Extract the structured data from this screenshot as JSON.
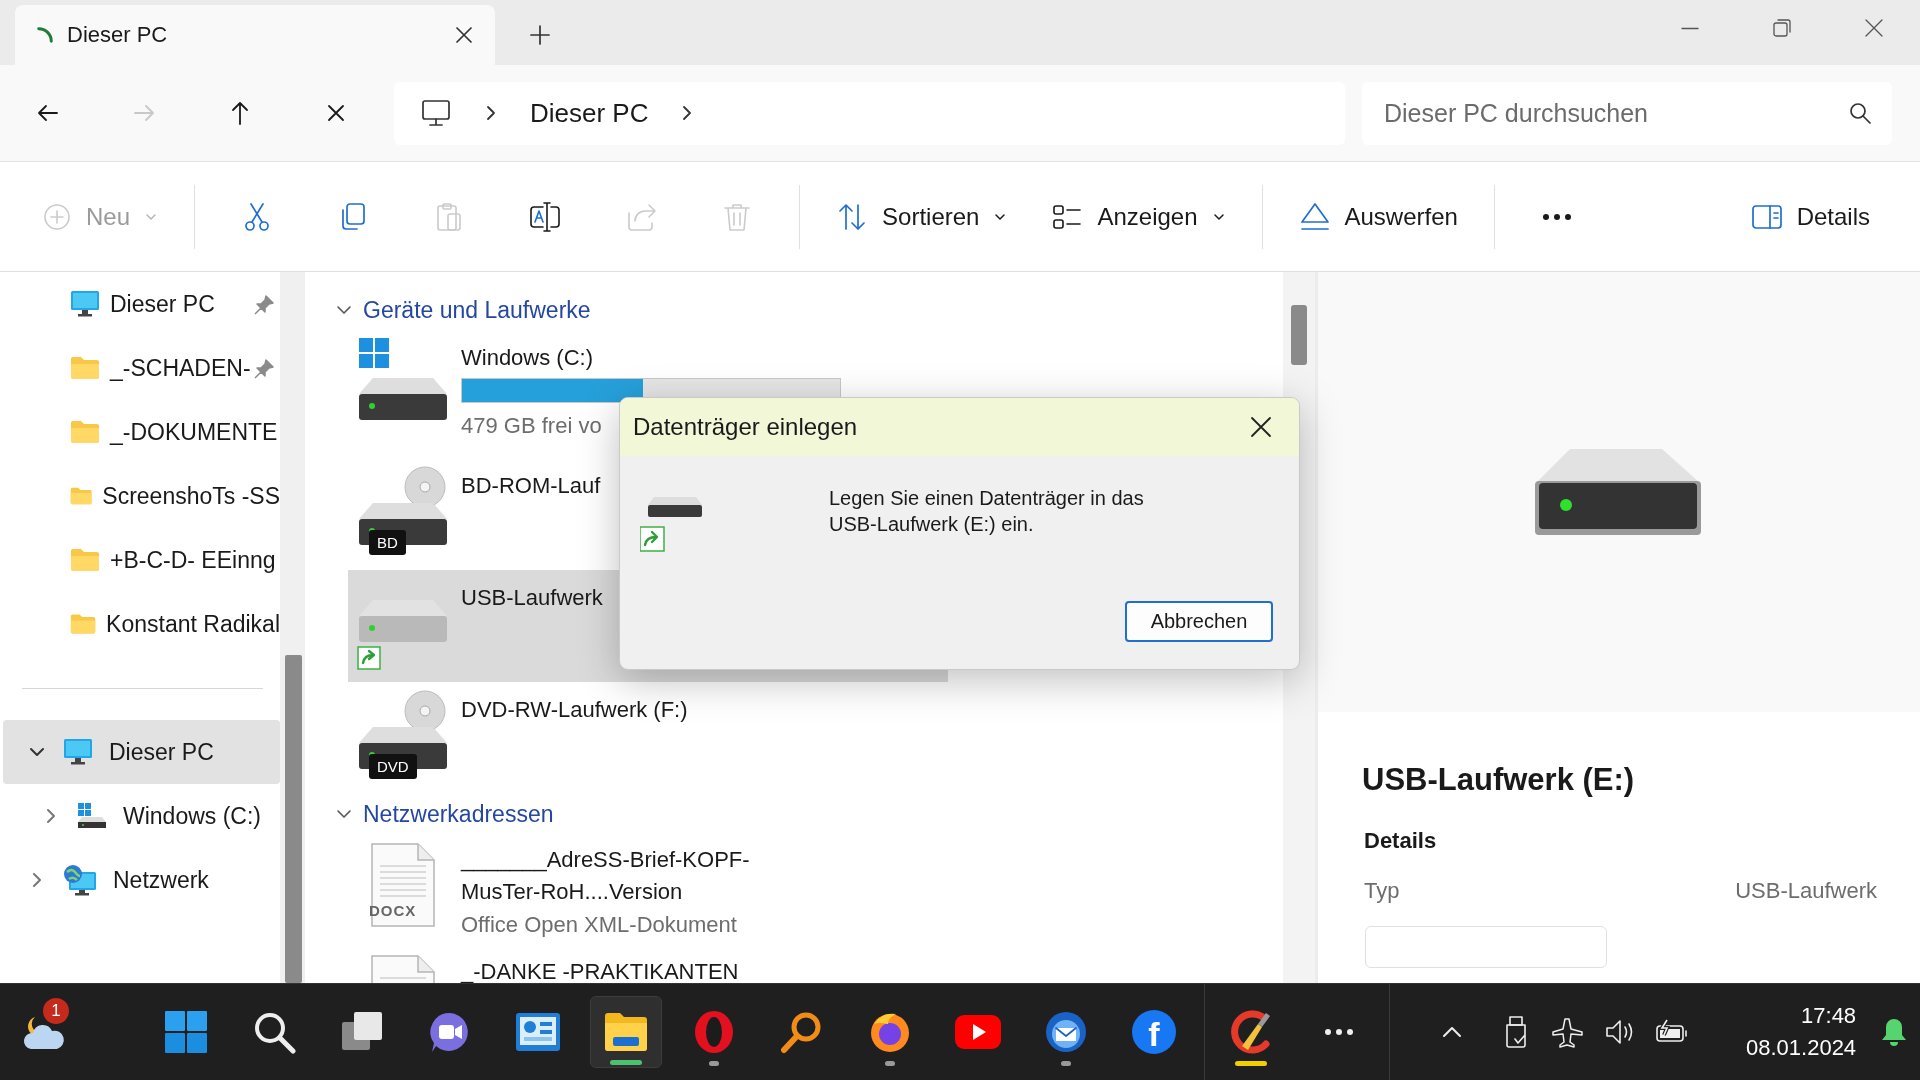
{
  "window": {
    "tab_title": "Dieser PC",
    "loading": true
  },
  "navigation": {
    "buttons": [
      {
        "kind": "back",
        "disabled": false
      },
      {
        "kind": "forward",
        "disabled": true
      },
      {
        "kind": "up",
        "disabled": false
      },
      {
        "kind": "stop",
        "disabled": false
      }
    ],
    "breadcrumb": [
      "Dieser PC"
    ],
    "search_placeholder": "Dieser PC durchsuchen"
  },
  "toolbar": {
    "items": [
      {
        "kind": "new",
        "label": "Neu",
        "disabled": true
      },
      {
        "kind": "cut",
        "disabled": false
      },
      {
        "kind": "copy",
        "disabled": false
      },
      {
        "kind": "paste",
        "disabled": true
      },
      {
        "kind": "rename",
        "disabled": false
      },
      {
        "kind": "share",
        "disabled": true
      },
      {
        "kind": "delete",
        "disabled": true
      },
      {
        "kind": "sort",
        "label": "Sortieren",
        "disabled": false
      },
      {
        "kind": "view",
        "label": "Anzeigen",
        "disabled": false
      },
      {
        "kind": "eject",
        "label": "Auswerfen",
        "disabled": false
      },
      {
        "kind": "more",
        "disabled": false
      }
    ],
    "details_label": "Details"
  },
  "sidebar": {
    "quick_access": [
      {
        "label": "Dieser PC",
        "kind": "pc",
        "pinned": true
      },
      {
        "label": "_-SCHADEN-",
        "kind": "folder",
        "pinned": true
      },
      {
        "label": "_-DOKUMENTE",
        "kind": "folder",
        "pinned": false
      },
      {
        "label": "ScreenshoTs -SS",
        "kind": "folder",
        "pinned": false
      },
      {
        "label": "+B-C-D- EEinng",
        "kind": "folder",
        "pinned": false
      },
      {
        "label": "Konstant Radikal",
        "kind": "folder",
        "pinned": false
      }
    ],
    "tree": [
      {
        "label": "Dieser PC",
        "kind": "pc",
        "expanded": true,
        "selected": true,
        "children": [
          {
            "label": "Windows (C:)",
            "kind": "drive",
            "expanded": false,
            "selected": false
          }
        ]
      },
      {
        "label": "Netzwerk",
        "kind": "network",
        "expanded": false,
        "selected": false
      }
    ]
  },
  "main": {
    "groups": [
      {
        "title": "Geräte und Laufwerke",
        "expanded": true,
        "items": [
          {
            "kind": "system",
            "name": "Windows (C:)",
            "level": 0.48,
            "detail": "479 GB frei vo",
            "selected": false
          },
          {
            "kind": "disc",
            "name": "BD-ROM-Lauf",
            "badge": "BD",
            "selected": false
          },
          {
            "kind": "usb",
            "name": "USB-Laufwerk",
            "selected": true
          },
          {
            "kind": "disc",
            "name": "DVD-RW-Laufwerk (F:)",
            "badge": "DVD",
            "selected": false
          }
        ]
      },
      {
        "title": "Netzwerkadressen",
        "expanded": true,
        "items": [
          {
            "kind": "document",
            "name": "_______AdreSS-Brief-KOPF-MusTer-RoH....Version",
            "badge": "DOCX",
            "detail": "Office Open XML-Dokument",
            "selected": false
          },
          {
            "kind": "document",
            "name": "_-DANKE -PRAKTIKANTEN",
            "selected": false
          }
        ]
      }
    ]
  },
  "details": {
    "title": "USB-Laufwerk (E:)",
    "section": "Details",
    "properties": [
      {
        "label": "Typ",
        "value": "USB-Laufwerk"
      }
    ]
  },
  "dialog": {
    "title": "Datenträger einlegen",
    "message": "Legen Sie einen Datenträger in das USB-Laufwerk (E:) ein.",
    "buttons": [
      {
        "label": "Abbrechen",
        "focused": true
      }
    ]
  },
  "taskbar": {
    "apps": [
      {
        "kind": "weather",
        "badge": "1",
        "running": false
      },
      {
        "kind": "start",
        "running": false
      },
      {
        "kind": "search",
        "running": false
      },
      {
        "kind": "taskview",
        "running": false
      },
      {
        "kind": "chat",
        "running": false
      },
      {
        "kind": "board",
        "running": false
      },
      {
        "kind": "explorer",
        "running": true,
        "highlighted": true,
        "color": "#4cc26e"
      },
      {
        "kind": "ring",
        "running": true
      },
      {
        "kind": "magnifier",
        "running": false
      },
      {
        "kind": "browser",
        "running": true
      },
      {
        "kind": "play",
        "running": false
      },
      {
        "kind": "mail",
        "running": true
      },
      {
        "kind": "social",
        "glyph": "f",
        "running": false
      }
    ],
    "overflow": [
      {
        "kind": "brush",
        "running": true,
        "color": "#f2d000"
      },
      {
        "kind": "more",
        "running": false
      }
    ],
    "time": "17:48",
    "date": "08.01.2024"
  }
}
